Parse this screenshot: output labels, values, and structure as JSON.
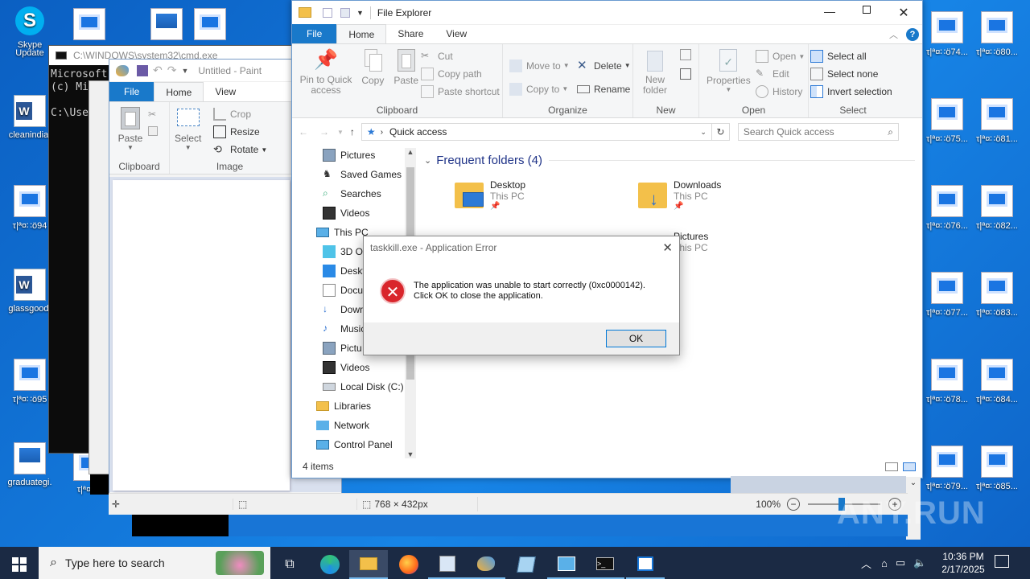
{
  "desktop": {
    "icons": [
      {
        "label": "Skype",
        "label2": "Update"
      },
      {
        "label": "cleanindia."
      },
      {
        "label": "τ|ª¤∷ö94"
      },
      {
        "label": "glassgood."
      },
      {
        "label": "τ|ª¤∷ö95"
      },
      {
        "label": "graduategi."
      },
      {
        "label": "τ|ª¤∷ö74..."
      },
      {
        "label": "τ|ª¤∷ö75..."
      },
      {
        "label": "τ|ª¤∷ö76..."
      },
      {
        "label": "τ|ª¤∷ö77..."
      },
      {
        "label": "τ|ª¤∷ö78..."
      },
      {
        "label": "τ|ª¤∷ö79..."
      },
      {
        "label": "τ|ª¤∷ö80..."
      },
      {
        "label": "τ|ª¤∷ö81..."
      },
      {
        "label": "τ|ª¤∷ö82..."
      },
      {
        "label": "τ|ª¤∷ö83..."
      },
      {
        "label": "τ|ª¤∷ö84..."
      },
      {
        "label": "τ|ª¤∷ö85..."
      },
      {
        "label": "τ|ª¤∷ö"
      }
    ]
  },
  "cmd": {
    "title": "C:\\WINDOWS\\system32\\cmd.exe",
    "lines": [
      "Microsoft",
      "(c) Mic",
      "",
      "C:\\User"
    ]
  },
  "paint": {
    "title": "Untitled - Paint",
    "tabs": {
      "file": "File",
      "home": "Home",
      "view": "View"
    },
    "ribbon": {
      "paste": "Paste",
      "clipboard": "Clipboard",
      "select": "Select",
      "crop": "Crop",
      "resize": "Resize",
      "rotate": "Rotate",
      "image": "Image"
    },
    "status": {
      "dimensions": "768 × 432px",
      "zoom": "100%"
    }
  },
  "explorer": {
    "title": "File Explorer",
    "tabs": {
      "file": "File",
      "home": "Home",
      "share": "Share",
      "view": "View"
    },
    "ribbon": {
      "pin": "Pin to Quick access",
      "copy": "Copy",
      "paste": "Paste",
      "cut": "Cut",
      "copy_path": "Copy path",
      "paste_shortcut": "Paste shortcut",
      "clipboard": "Clipboard",
      "move_to": "Move to",
      "copy_to": "Copy to",
      "delete": "Delete",
      "rename": "Rename",
      "organize": "Organize",
      "new_folder": "New folder",
      "new": "New",
      "properties": "Properties",
      "open": "Open",
      "edit": "Edit",
      "history": "History",
      "open_group": "Open",
      "select_all": "Select all",
      "select_none": "Select none",
      "invert_selection": "Invert selection",
      "select_group": "Select"
    },
    "address": "Quick access",
    "search_placeholder": "Search Quick access",
    "nav": [
      {
        "label": "Pictures"
      },
      {
        "label": "Saved Games"
      },
      {
        "label": "Searches"
      },
      {
        "label": "Videos"
      },
      {
        "label": "This PC"
      },
      {
        "label": "3D Ob"
      },
      {
        "label": "Deskt"
      },
      {
        "label": "Docu"
      },
      {
        "label": "Dowr"
      },
      {
        "label": "Music"
      },
      {
        "label": "Pictu"
      },
      {
        "label": "Videos"
      },
      {
        "label": "Local Disk (C:)"
      },
      {
        "label": "Libraries"
      },
      {
        "label": "Network"
      },
      {
        "label": "Control Panel"
      }
    ],
    "section_title": "Frequent folders (4)",
    "folders": [
      {
        "name": "Desktop",
        "location": "This PC"
      },
      {
        "name": "Downloads",
        "location": "This PC"
      },
      {
        "name": "Pictures",
        "location": "This PC"
      }
    ],
    "status": "4 items"
  },
  "dialog": {
    "title": "taskkill.exe - Application Error",
    "message_line1": "The application was unable to start correctly (0xc0000142).",
    "message_line2": "Click OK to close the application.",
    "ok": "OK"
  },
  "taskbar": {
    "search_placeholder": "Type here to search",
    "time": "10:36 PM",
    "date": "2/17/2025"
  },
  "watermark": "ANY.RUN",
  "colors": {
    "accent": "#1979ca",
    "desktop": "#0f6fd3",
    "taskbar": "#1b2a44",
    "error": "#d9262c"
  }
}
